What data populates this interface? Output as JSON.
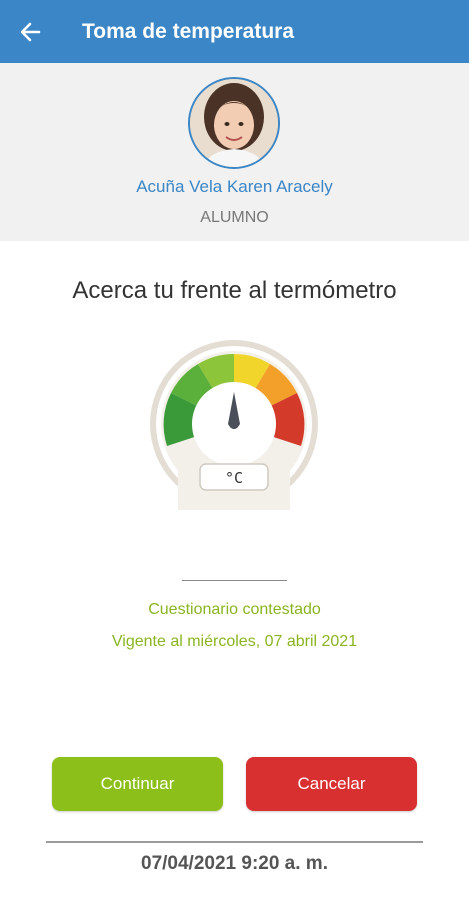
{
  "appbar": {
    "title": "Toma de temperatura",
    "back_icon": "arrow-left-icon",
    "color": "#3a86c6"
  },
  "student": {
    "name": "Acuña Vela Karen Aracely",
    "role": "ALUMNO"
  },
  "main": {
    "instruction": "Acerca tu frente al termómetro",
    "gauge_unit": "°C",
    "status_answered": "Cuestionario contestado",
    "status_valid": "Vigente al miércoles, 07 abril 2021"
  },
  "actions": {
    "continue_label": "Continuar",
    "cancel_label": "Cancelar",
    "continue_color": "#8dbf1a",
    "cancel_color": "#d83030"
  },
  "footer": {
    "timestamp": "07/04/2021 9:20 a. m."
  }
}
